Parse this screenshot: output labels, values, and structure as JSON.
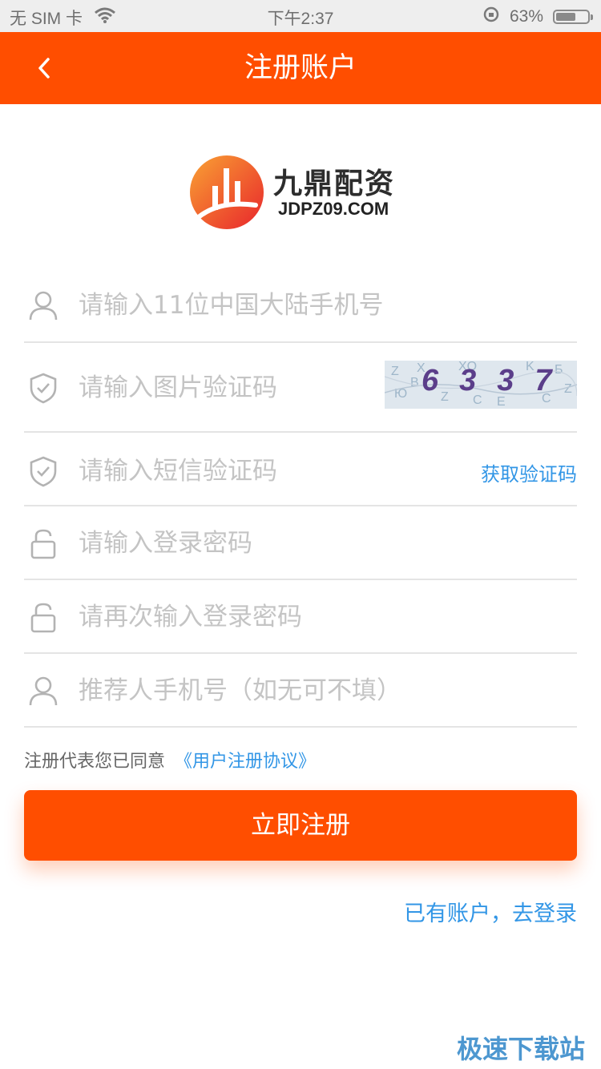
{
  "status_bar": {
    "carrier": "无 SIM 卡",
    "time": "下午2:37",
    "battery_text": "63%",
    "battery_level": 0.63
  },
  "nav": {
    "title": "注册账户",
    "back_icon": "chevron-left-icon"
  },
  "logo": {
    "name_cn": "九鼎配资",
    "domain": "JDPZ09.COM"
  },
  "form": {
    "phone_placeholder": "请输入11位中国大陆手机号",
    "captcha_placeholder": "请输入图片验证码",
    "captcha_text": "6337",
    "sms_placeholder": "请输入短信验证码",
    "sms_button": "获取验证码",
    "password_placeholder": "请输入登录密码",
    "password_confirm_placeholder": "请再次输入登录密码",
    "referrer_placeholder": "推荐人手机号（如无可不填）"
  },
  "agreement": {
    "prefix": "注册代表您已同意",
    "link": "《用户注册协议》"
  },
  "submit_label": "立即注册",
  "login_link": "已有账户，去登录",
  "watermark": "极速下载站",
  "colors": {
    "brand": "#ff4e00",
    "link": "#3296e6"
  }
}
